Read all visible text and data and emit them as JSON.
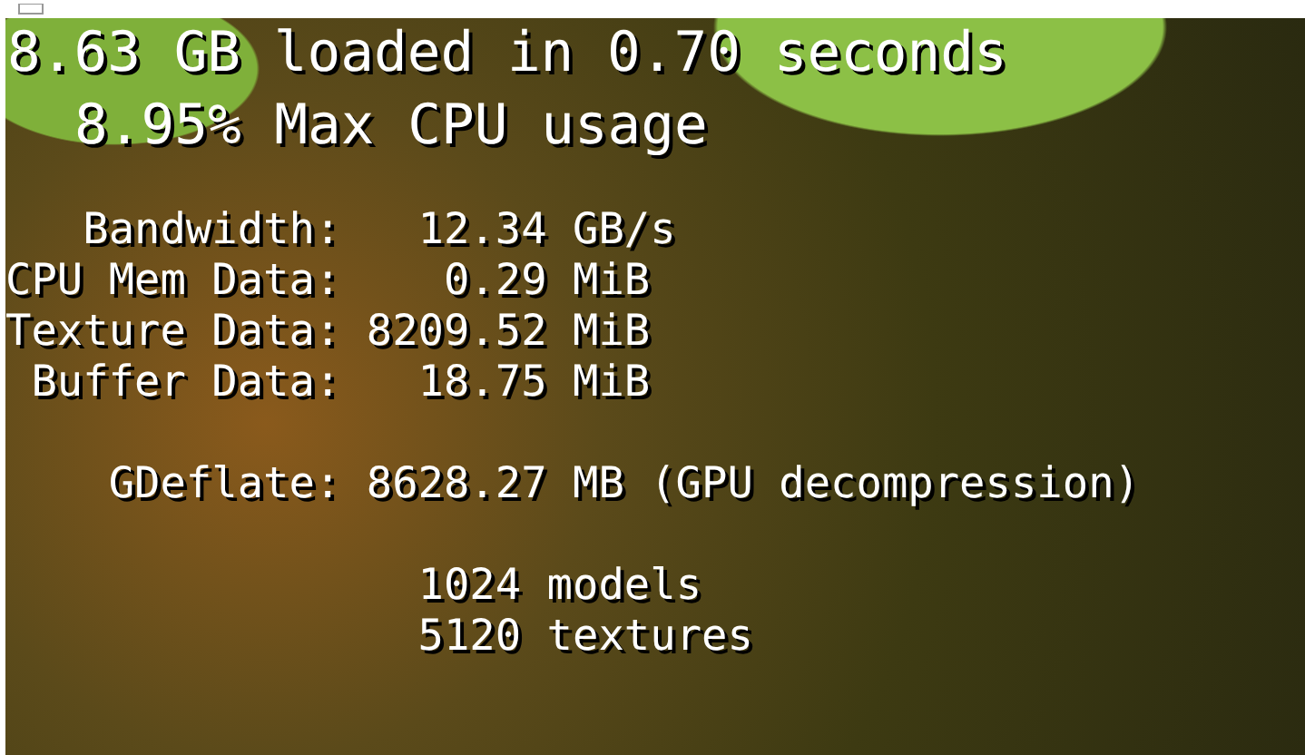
{
  "headline": {
    "loaded": "8.63 GB loaded in 0.70 seconds",
    "cpu": "8.95% Max CPU usage"
  },
  "stats": [
    {
      "label": "Bandwidth:",
      "value": "12.34",
      "unit": "GB/s"
    },
    {
      "label": "CPU Mem Data:",
      "value": "0.29",
      "unit": "MiB"
    },
    {
      "label": "Texture Data:",
      "value": "8209.52",
      "unit": "MiB"
    },
    {
      "label": "Buffer Data:",
      "value": "18.75",
      "unit": "MiB"
    }
  ],
  "compression": {
    "label": "GDeflate:",
    "value": "8628.27",
    "unit": "MB (GPU decompression)"
  },
  "counts": [
    {
      "value": "1024",
      "unit": "models"
    },
    {
      "value": "5120",
      "unit": "textures"
    }
  ]
}
